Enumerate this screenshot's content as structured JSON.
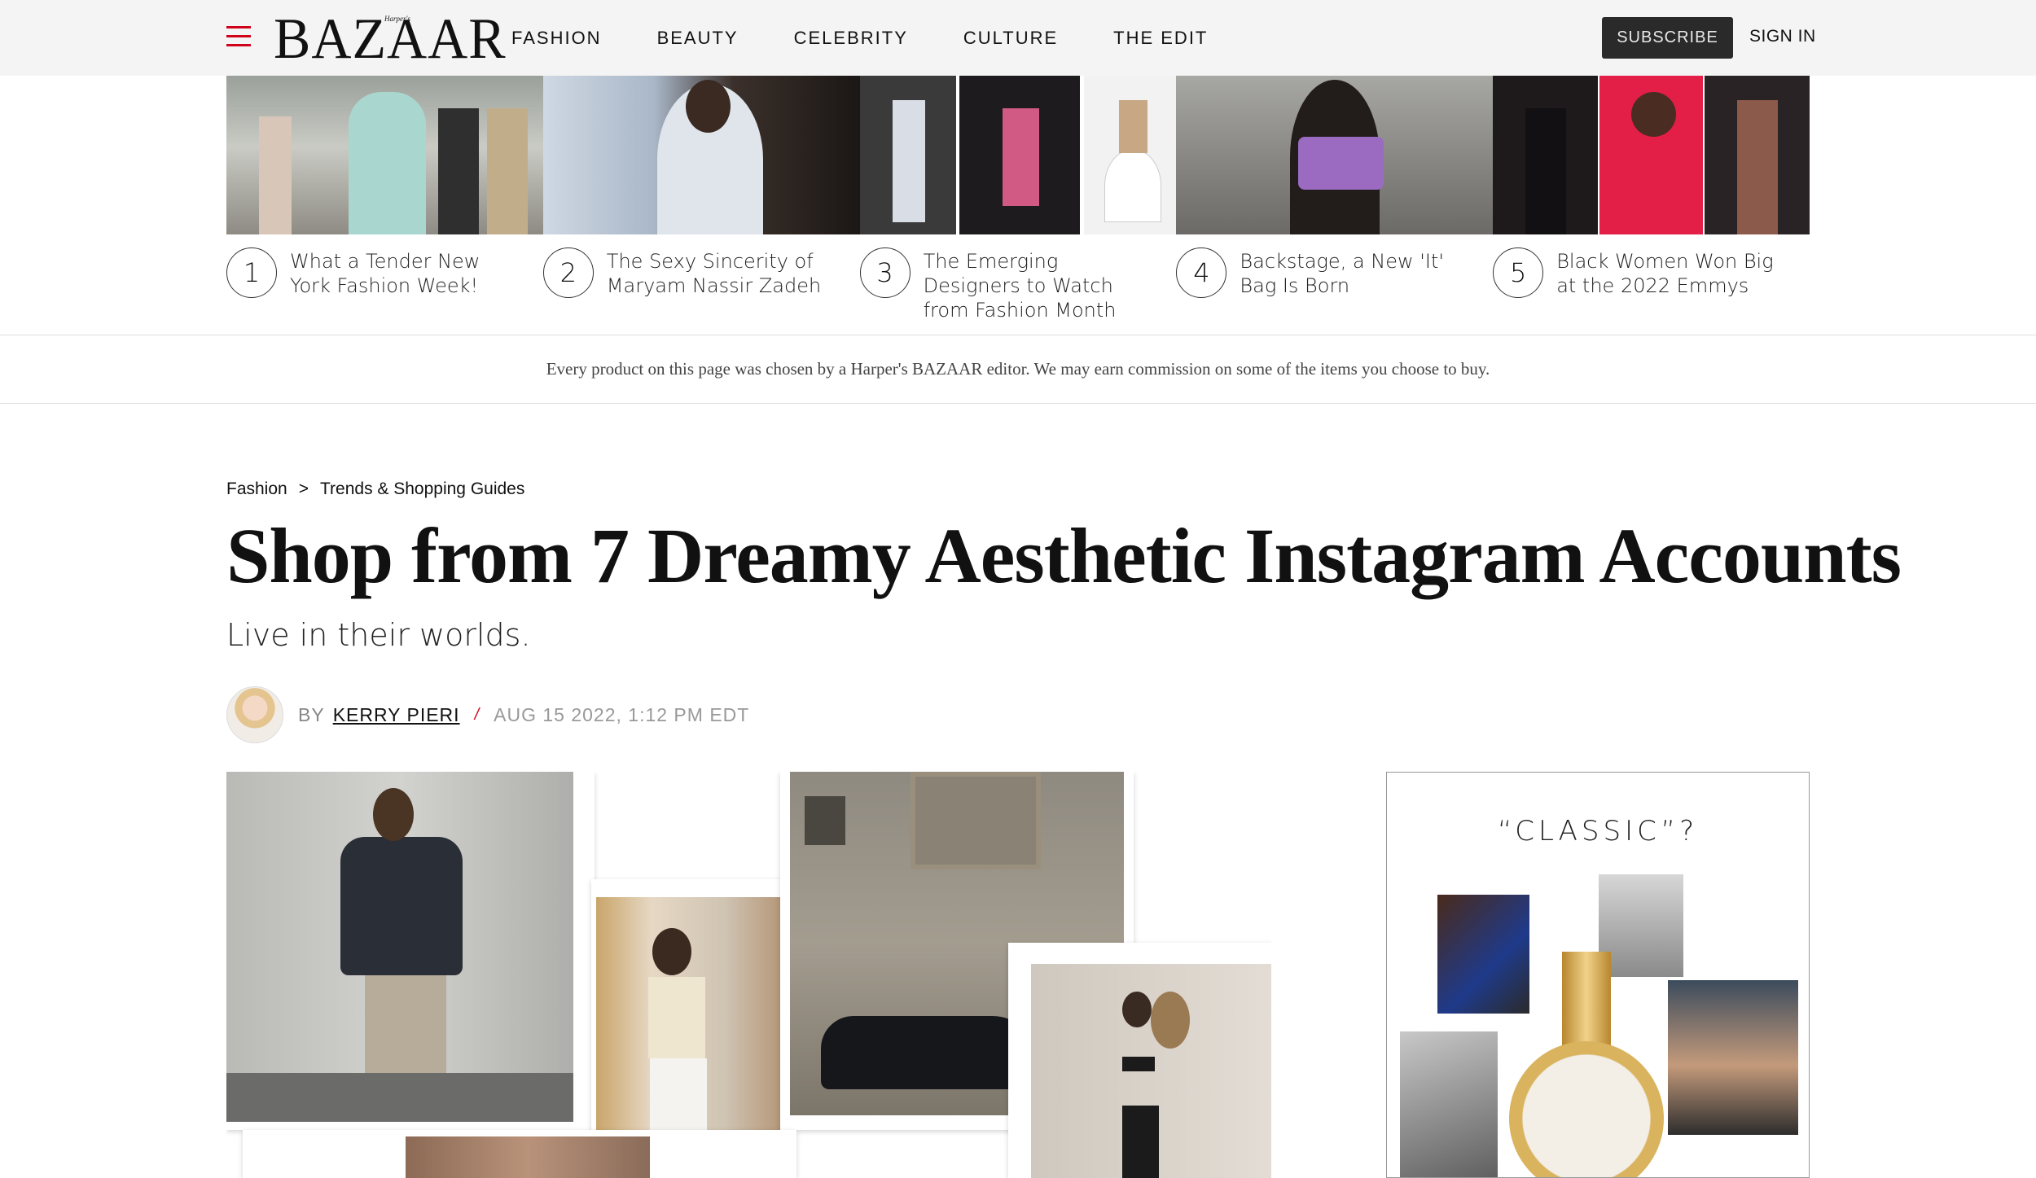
{
  "header": {
    "logo_small": "Harper's",
    "logo": "BAZAAR",
    "nav": [
      "FASHION",
      "BEAUTY",
      "CELEBRITY",
      "CULTURE",
      "THE EDIT"
    ],
    "subscribe": "SUBSCRIBE",
    "sign_in": "SIGN IN"
  },
  "trending": [
    {
      "num": "1",
      "title": "What a Tender New York Fashion Week!"
    },
    {
      "num": "2",
      "title": "The Sexy Sincerity of Maryam Nassir Zadeh"
    },
    {
      "num": "3",
      "title": "The Emerging Designers to Watch from Fashion Month"
    },
    {
      "num": "4",
      "title": "Backstage, a New 'It' Bag Is Born"
    },
    {
      "num": "5",
      "title": "Black Women Won Big at the 2022 Emmys"
    }
  ],
  "disclaimer": "Every product on this page was chosen by a Harper's BAZAAR editor. We may earn commission on some of the items you choose to buy.",
  "article": {
    "breadcrumb": [
      "Fashion",
      ">",
      "Trends & Shopping Guides"
    ],
    "title": "Shop from 7 Dreamy Aesthetic Instagram Accounts",
    "dek": "Live in their worlds.",
    "by": "BY",
    "author": "KERRY PIERI",
    "separator": "/",
    "date": "AUG 15 2022, 1:12 PM EDT"
  },
  "ad": {
    "title": "“CLASSIC”?"
  },
  "colors": {
    "accent": "#d0021b",
    "topbar": "#f4f4f4",
    "subscribe_bg": "#2a2a2a"
  }
}
